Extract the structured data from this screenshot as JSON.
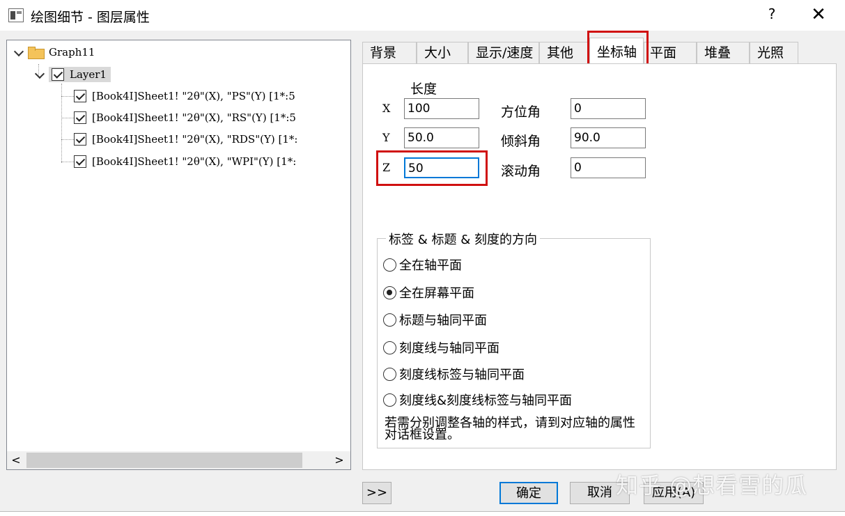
{
  "window": {
    "title": "绘图细节 - 图层属性",
    "help": "?",
    "close": "✕"
  },
  "tree": {
    "root": "Graph11",
    "layer": "Layer1",
    "items": [
      "[Book4I]Sheet1! \"2θ\"(X), \"PS\"(Y) [1*:5",
      "[Book4I]Sheet1! \"2θ\"(X), \"RS\"(Y) [1*:5",
      "[Book4I]Sheet1! \"2θ\"(X), \"RDS\"(Y) [1*:",
      "[Book4I]Sheet1! \"2θ\"(X), \"WPI\"(Y) [1*:"
    ],
    "scroll_left": "<",
    "scroll_right": ">"
  },
  "tabs": [
    "背景",
    "大小",
    "显示/速度",
    "其他",
    "坐标轴",
    "平面",
    "堆叠",
    "光照"
  ],
  "axis": {
    "length_label": "长度",
    "x_label": "X",
    "y_label": "Y",
    "z_label": "Z",
    "x_value": "100",
    "y_value": "50.0",
    "z_value": "50",
    "azimuth_label": "方位角",
    "azimuth_value": "0",
    "tilt_label": "倾斜角",
    "tilt_value": "90.0",
    "roll_label": "滚动角",
    "roll_value": "0"
  },
  "orientation": {
    "title": "标签 & 标题 & 刻度的方向",
    "options": [
      "全在轴平面",
      "全在屏幕平面",
      "标题与轴同平面",
      "刻度线与轴同平面",
      "刻度线标签与轴同平面",
      "刻度线&刻度线标签与轴同平面"
    ],
    "selected_index": 1,
    "note": "若需分别调整各轴的样式，请到对应轴的属性对话框设置。"
  },
  "buttons": {
    "expand": ">>",
    "ok": "确定",
    "cancel": "取消",
    "apply": "应用(A)"
  },
  "watermark": "知乎 @想看雪的瓜"
}
